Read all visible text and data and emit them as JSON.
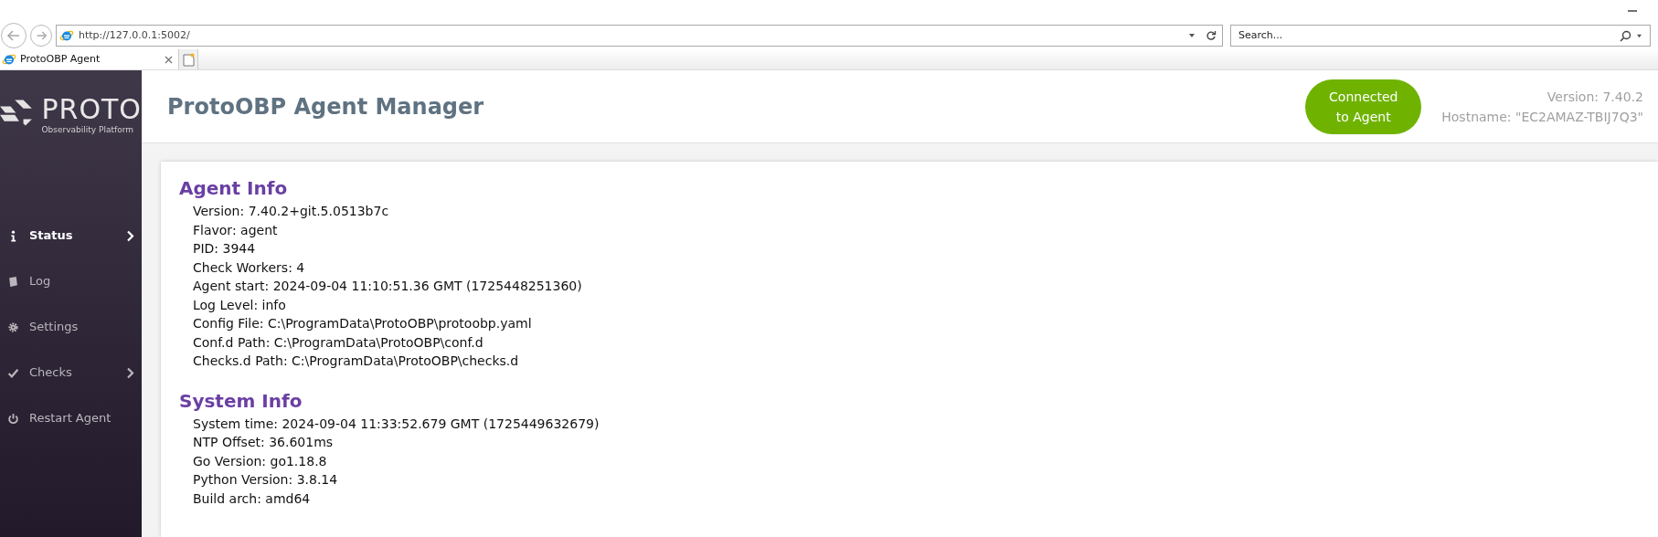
{
  "browser": {
    "address": "http://127.0.0.1:5002/",
    "search_placeholder": "Search...",
    "tab": {
      "title": "ProtoOBP Agent",
      "selected": true
    }
  },
  "sidebar": {
    "logo_text": "PROTO",
    "logo_subtitle": "Observability Platform",
    "items": [
      {
        "label": "Status",
        "selected": true,
        "has_submenu": true
      },
      {
        "label": "Log",
        "selected": false,
        "has_submenu": false
      },
      {
        "label": "Settings",
        "selected": false,
        "has_submenu": false
      },
      {
        "label": "Checks",
        "selected": false,
        "has_submenu": true
      },
      {
        "label": "Restart Agent",
        "selected": false,
        "has_submenu": false
      }
    ]
  },
  "header": {
    "title": "ProtoOBP Agent Manager",
    "connection": {
      "label": "Connected to Agent",
      "connected": true
    },
    "version": "Version: 7.40.2",
    "hostname": "Hostname: \"EC2AMAZ-TBIJ7Q3\""
  },
  "sections": [
    {
      "title": "Agent Info",
      "lines": [
        "Version: 7.40.2+git.5.0513b7c",
        "Flavor: agent",
        "PID: 3944",
        "Check Workers: 4",
        "Agent start: 2024-09-04 11:10:51.36 GMT (1725448251360)",
        "Log Level: info",
        "Config File: C:\\ProgramData\\ProtoOBP\\protoobp.yaml",
        "Conf.d Path: C:\\ProgramData\\ProtoOBP\\conf.d",
        "Checks.d Path: C:\\ProgramData\\ProtoOBP\\checks.d"
      ]
    },
    {
      "title": "System Info",
      "lines": [
        "System time: 2024-09-04 11:33:52.679 GMT (1725449632679)",
        "NTP Offset: 36.601ms",
        "Go Version: go1.18.8",
        "Python Version: 3.8.14",
        "Build arch: amd64"
      ]
    }
  ]
}
